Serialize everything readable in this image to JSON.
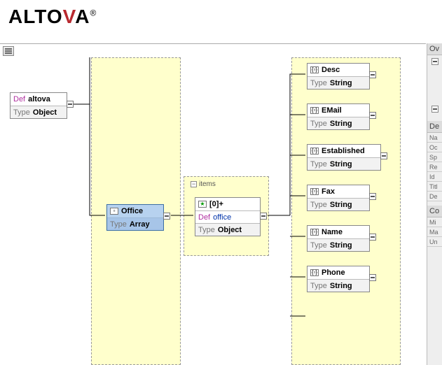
{
  "brand": {
    "name_part1": "ALTO",
    "name_v": "V",
    "name_part2": "A",
    "reg": "®"
  },
  "items_label": "items",
  "nodes": {
    "altova": {
      "prefix": "Def",
      "name": "altova",
      "type_lbl": "Type",
      "type": "Object"
    },
    "office": {
      "icon": "▫",
      "name": "Office",
      "type_lbl": "Type",
      "type": "Array"
    },
    "array_item": {
      "icon": "★",
      "card": "[0]+",
      "def": "Def",
      "ref": "office",
      "type_lbl": "Type",
      "type": "Object"
    },
    "desc": {
      "icon": "{▫}",
      "name": "Desc",
      "type_lbl": "Type",
      "type": "String"
    },
    "email": {
      "icon": "{▫}",
      "name": "EMail",
      "type_lbl": "Type",
      "type": "String"
    },
    "established": {
      "icon": "{▫}",
      "name": "Established",
      "type_lbl": "Type",
      "type": "String"
    },
    "fax": {
      "icon": "{▫}",
      "name": "Fax",
      "type_lbl": "Type",
      "type": "String"
    },
    "name": {
      "icon": "{▫}",
      "name": "Name",
      "type_lbl": "Type",
      "type": "String"
    },
    "phone": {
      "icon": "{▫}",
      "name": "Phone",
      "type_lbl": "Type",
      "type": "String"
    }
  },
  "side": {
    "overview": "Ov",
    "details": "De",
    "constraints": "Co",
    "rows": [
      "Na",
      "Oc",
      "Sp",
      "Re",
      "Id",
      "Titl",
      "De"
    ],
    "rows2": [
      "Mi",
      "Ma",
      "Un"
    ]
  }
}
